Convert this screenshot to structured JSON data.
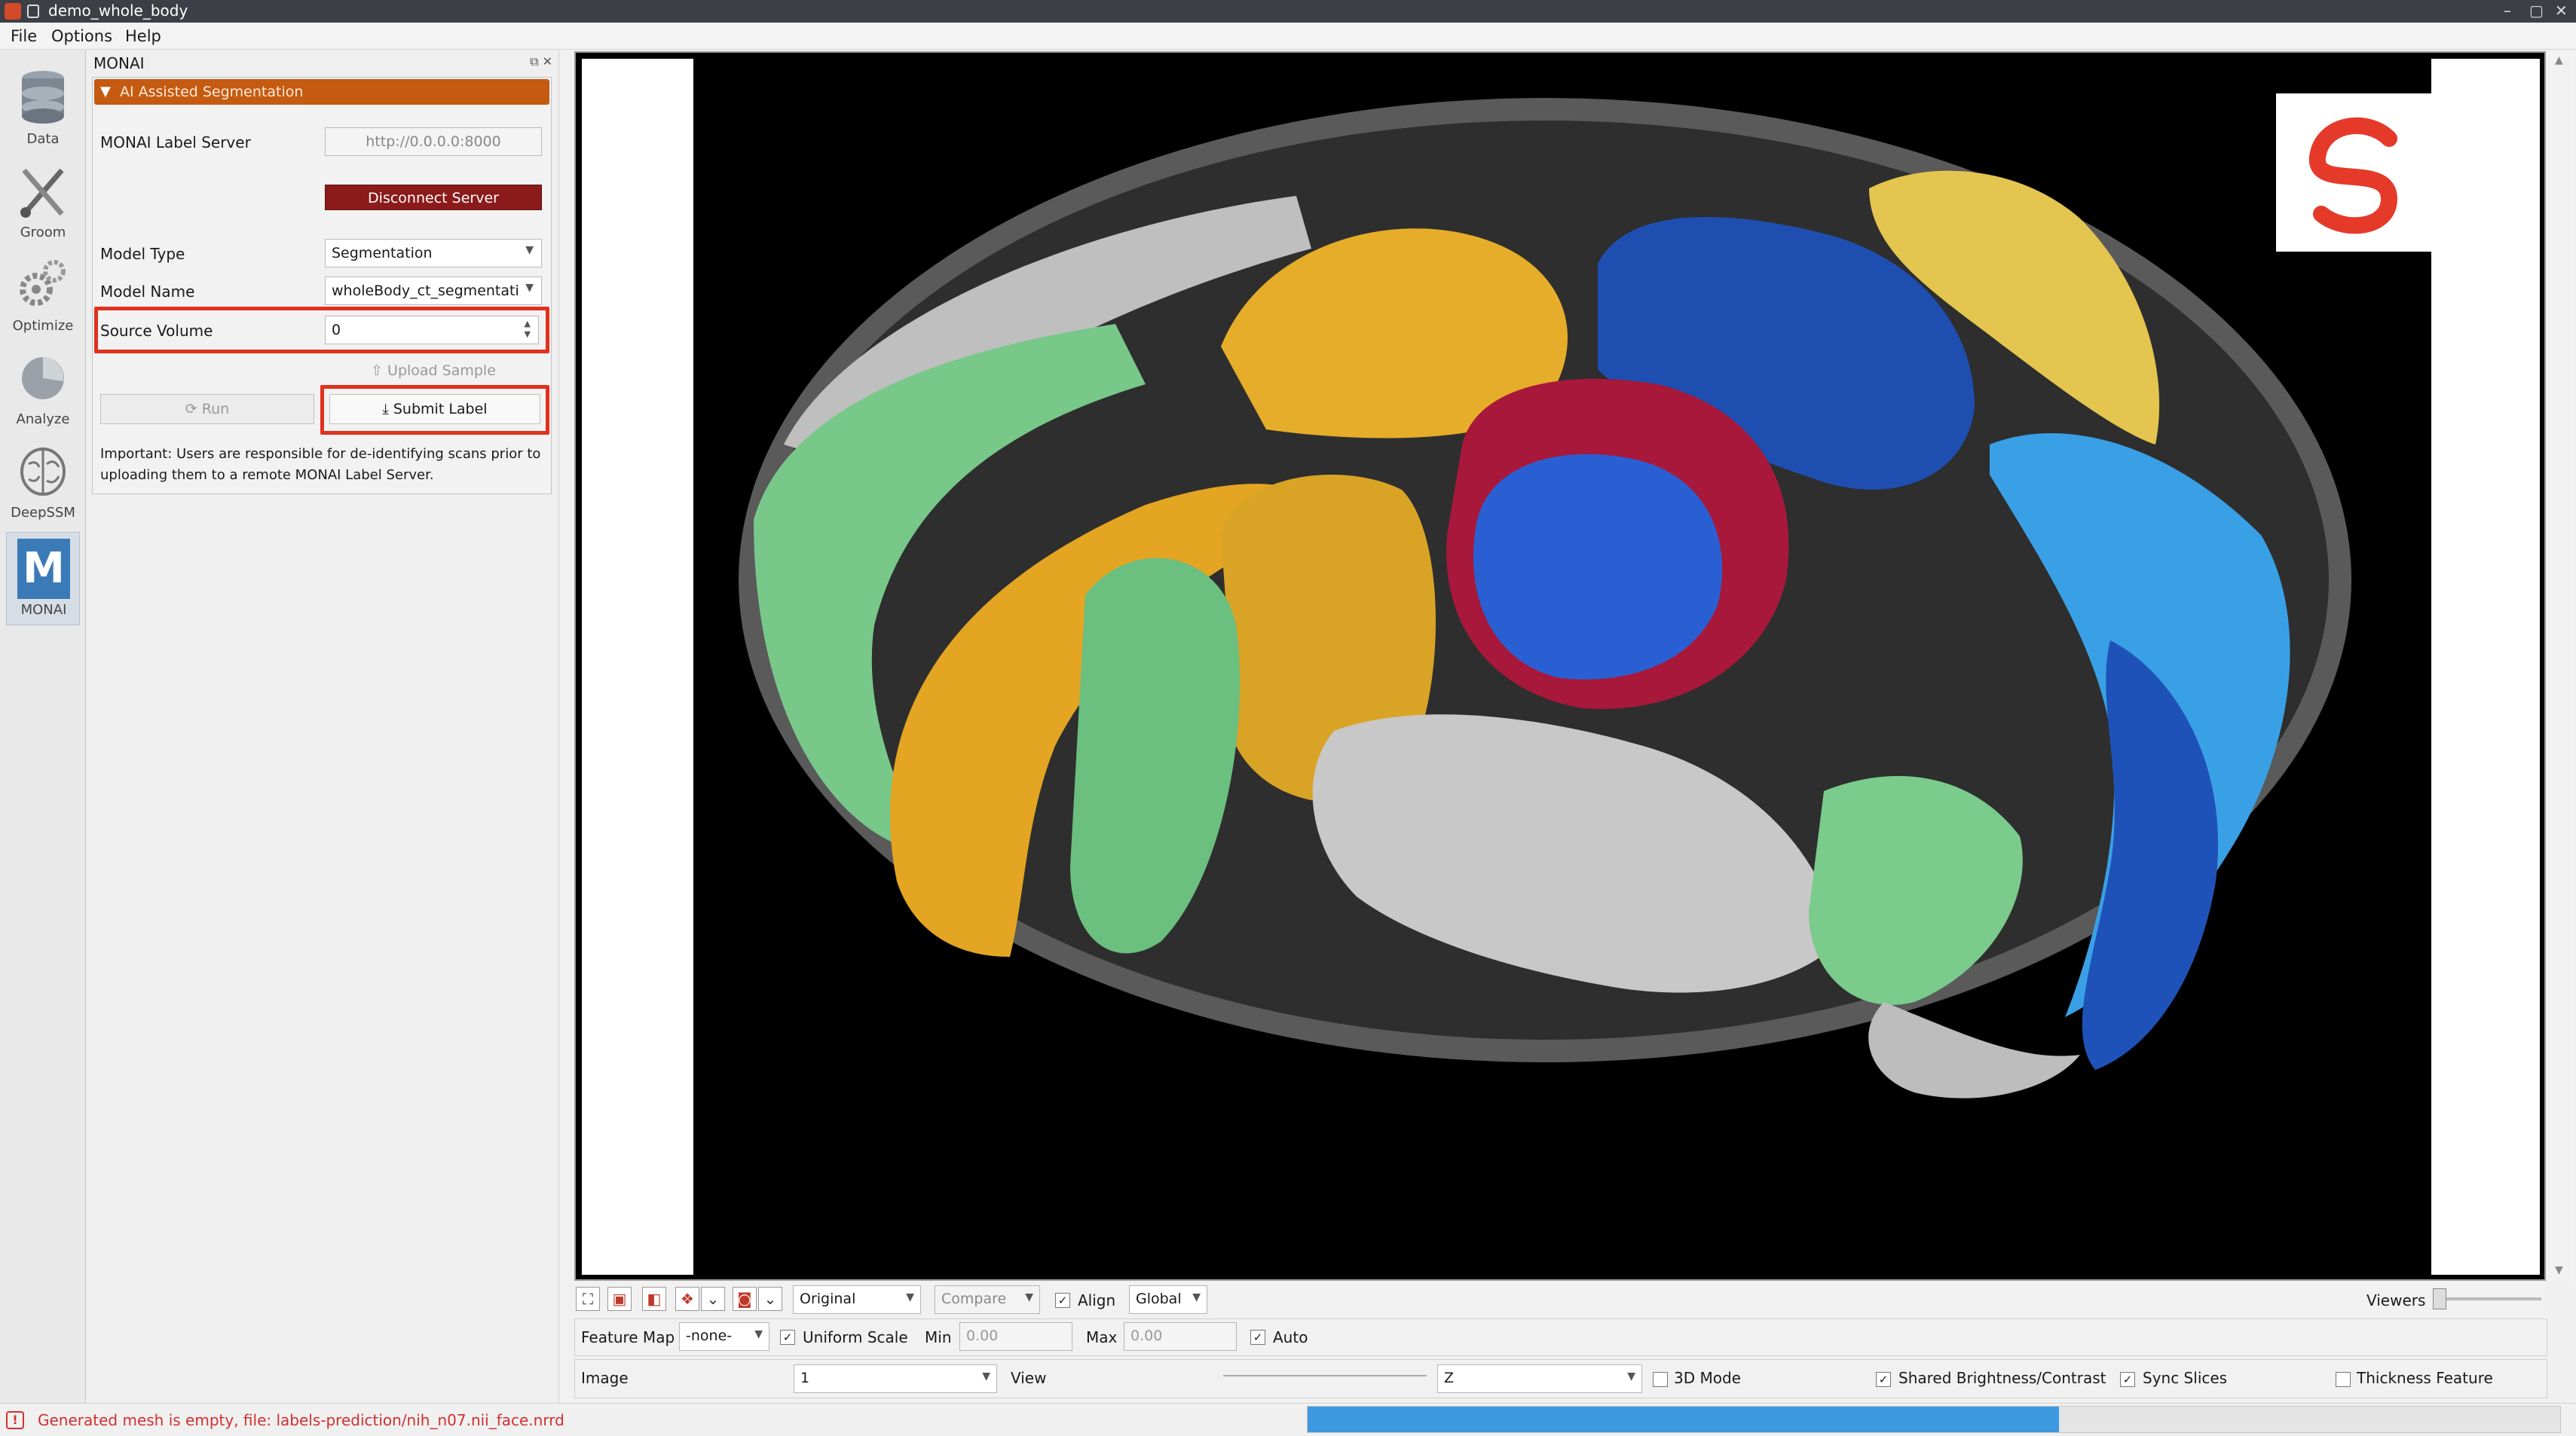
{
  "window": {
    "title": "demo_whole_body",
    "minimize": "–",
    "maximize": "▢",
    "close": "✕"
  },
  "menu": {
    "file": "File",
    "options": "Options",
    "help": "Help"
  },
  "tools": {
    "data": "Data",
    "groom": "Groom",
    "optimize": "Optimize",
    "analyze": "Analyze",
    "deepssm": "DeepSSM",
    "monai": "MONAI",
    "monai_letter": "M"
  },
  "panel": {
    "title": "MONAI",
    "section_title": "AI Assisted Segmentation",
    "server_label": "MONAI Label Server",
    "server_value": "http://0.0.0.0:8000",
    "disconnect_label": "Disconnect Server",
    "model_type_label": "Model Type",
    "model_type_value": "Segmentation",
    "model_name_label": "Model Name",
    "model_name_value": "wholeBody_ct_segmentati",
    "source_volume_label": "Source Volume",
    "source_volume_value": "0",
    "upload_label": "Upload Sample",
    "run_label": "Run",
    "submit_label": "Submit Label",
    "note": "Important: Users are responsible for de-identifying scans prior to uploading them to a remote MONAI Label Server."
  },
  "controls": {
    "view_mode": "Original",
    "compare": "Compare",
    "align": "Align",
    "align_mode": "Global",
    "viewers": "Viewers",
    "feature_map_label": "Feature Map",
    "feature_map_value": "-none-",
    "uniform_scale": "Uniform Scale",
    "min_label": "Min",
    "min_value": "0.00",
    "max_label": "Max",
    "max_value": "0.00",
    "auto": "Auto",
    "image_label": "Image",
    "image_value": "1",
    "view_label": "View",
    "axis_value": "Z",
    "mode_3d": "3D Mode",
    "shared_bc": "Shared Brightness/Contrast",
    "sync_slices": "Sync Slices",
    "thickness_feature": "Thickness Feature"
  },
  "status": {
    "message": "Generated mesh is empty, file: labels-prediction/nih_n07.nii_face.nrrd",
    "progress": 0.6
  },
  "colors": {
    "accent": "#c55a11",
    "disconnect": "#8b1a1a",
    "highlight": "#e0311f",
    "progress": "#3d9ae0"
  }
}
